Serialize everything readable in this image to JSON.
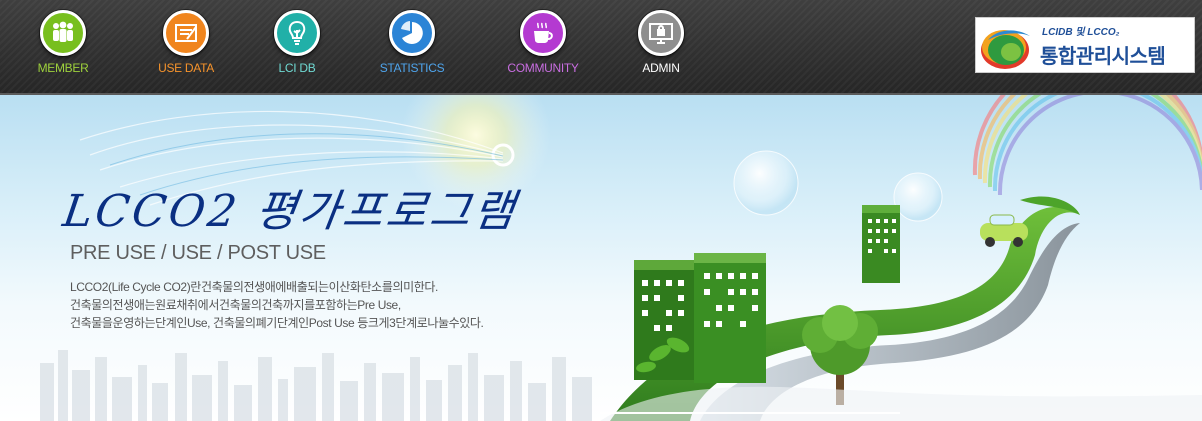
{
  "nav": {
    "items": [
      {
        "label": "MEMBER",
        "color": "#78bf1e",
        "label_color": "#9ed13c",
        "icon": "people-icon"
      },
      {
        "label": "USE DATA",
        "color": "#f0851e",
        "label_color": "#f6932b",
        "icon": "document-icon"
      },
      {
        "label": "LCI DB",
        "color": "#21b0a8",
        "label_color": "#6fd9d2",
        "icon": "lightbulb-icon"
      },
      {
        "label": "STATISTICS",
        "color": "#2b84d6",
        "label_color": "#4ea4ec",
        "icon": "pie-chart-icon"
      },
      {
        "label": "COMMUNITY",
        "color": "#b43ad1",
        "label_color": "#c86de0",
        "icon": "coffee-cup-icon"
      },
      {
        "label": "ADMIN",
        "color": "#8e8e8e",
        "label_color": "#ffffff",
        "icon": "monitor-lock-icon"
      }
    ]
  },
  "brand": {
    "small": "LCIDB 및 LCCO₂",
    "big": "통합관리시스템"
  },
  "hero": {
    "title": "LCCO2 평가프로그램",
    "subtitle": "PRE USE / USE / POST USE",
    "desc": [
      "LCCO2(Life Cycle CO2)란건축물의전생애에배출되는이산화탄소를의미한다.",
      "건축물의전생애는원료채취에서건축물의건축까지를포함하는Pre Use,",
      "건축물을운영하는단계인Use, 건축물의폐기단계인Post Use 등크게3단계로나눌수있다."
    ]
  }
}
